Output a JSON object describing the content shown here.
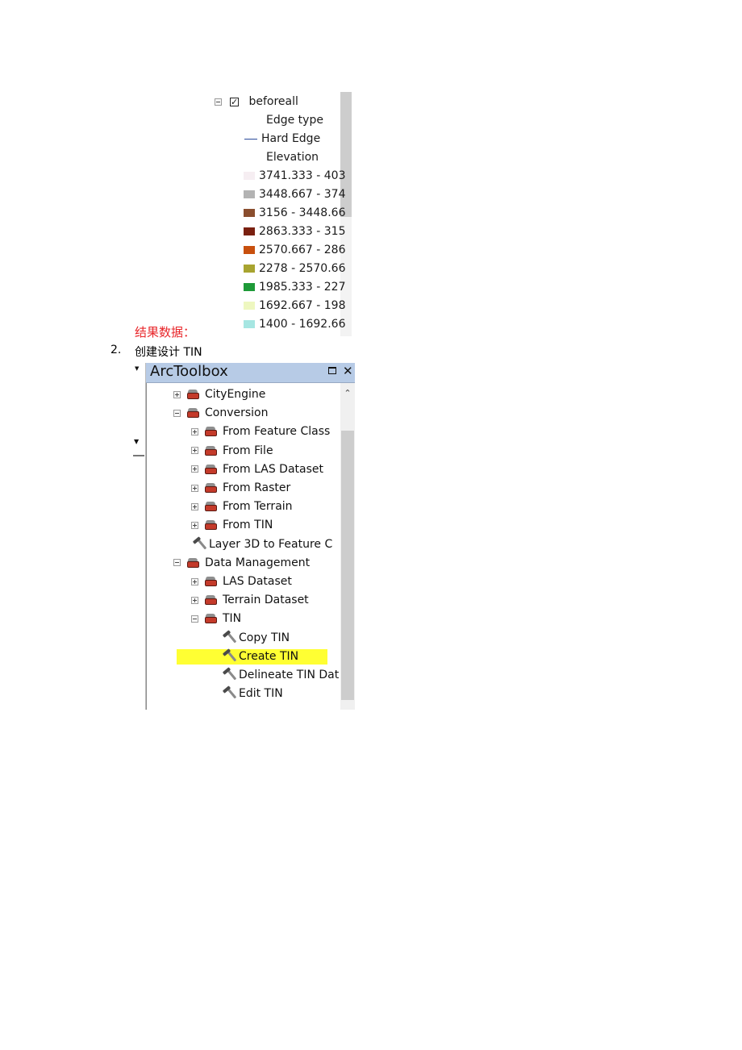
{
  "legend": {
    "layer_name": "beforeall",
    "layer_checked": true,
    "groups": [
      {
        "heading": "Edge type",
        "items": [
          {
            "label": "Hard Edge",
            "symbol": "line",
            "color": "#2a4a9a"
          }
        ]
      },
      {
        "heading": "Elevation",
        "items": [
          {
            "label": "3741.333 - 403",
            "symbol": "swatch",
            "color": "#f6eef2"
          },
          {
            "label": "3448.667 - 374",
            "symbol": "swatch",
            "color": "#b3b3b3"
          },
          {
            "label": "3156 - 3448.66",
            "symbol": "swatch",
            "color": "#8a4e2e"
          },
          {
            "label": "2863.333 - 315",
            "symbol": "swatch",
            "color": "#7a2010"
          },
          {
            "label": "2570.667 - 286",
            "symbol": "swatch",
            "color": "#c8500e"
          },
          {
            "label": "2278 - 2570.66",
            "symbol": "swatch",
            "color": "#a8a430"
          },
          {
            "label": "1985.333 - 227",
            "symbol": "swatch",
            "color": "#1e9a38"
          },
          {
            "label": "1692.667 - 198",
            "symbol": "swatch",
            "color": "#eef7c0"
          },
          {
            "label": "1400 - 1692.66",
            "symbol": "swatch",
            "color": "#a6e6e2"
          }
        ]
      }
    ]
  },
  "doc": {
    "result_label": "结果数据：",
    "step_number": "2.",
    "step_text": "创建设计 TIN"
  },
  "toolbox": {
    "title": "ArcToolbox",
    "highlight_color": "#ffff33",
    "items": [
      {
        "label": "CityEngine",
        "level": 0,
        "toggle": "plus",
        "icon": "toolbox"
      },
      {
        "label": "Conversion",
        "level": 0,
        "toggle": "minus",
        "icon": "toolbox"
      },
      {
        "label": "From Feature Class",
        "level": 1,
        "toggle": "plus",
        "icon": "toolbox"
      },
      {
        "label": "From File",
        "level": 1,
        "toggle": "plus",
        "icon": "toolbox"
      },
      {
        "label": "From LAS Dataset",
        "level": 1,
        "toggle": "plus",
        "icon": "toolbox"
      },
      {
        "label": "From Raster",
        "level": 1,
        "toggle": "plus",
        "icon": "toolbox"
      },
      {
        "label": "From Terrain",
        "level": 1,
        "toggle": "plus",
        "icon": "toolbox"
      },
      {
        "label": "From TIN",
        "level": 1,
        "toggle": "plus",
        "icon": "toolbox"
      },
      {
        "label": "Layer 3D to Feature C",
        "level": 1,
        "toggle": "none",
        "icon": "hammer"
      },
      {
        "label": "Data Management",
        "level": 0,
        "toggle": "minus",
        "icon": "toolbox"
      },
      {
        "label": "LAS Dataset",
        "level": 1,
        "toggle": "plus",
        "icon": "toolbox"
      },
      {
        "label": "Terrain Dataset",
        "level": 1,
        "toggle": "plus",
        "icon": "toolbox"
      },
      {
        "label": "TIN",
        "level": 1,
        "toggle": "minus",
        "icon": "toolbox"
      },
      {
        "label": "Copy TIN",
        "level": 2,
        "toggle": "none",
        "icon": "hammer"
      },
      {
        "label": "Create TIN",
        "level": 2,
        "toggle": "none",
        "icon": "hammer",
        "highlighted": true
      },
      {
        "label": "Delineate TIN Dat",
        "level": 2,
        "toggle": "none",
        "icon": "hammer"
      },
      {
        "label": "Edit TIN",
        "level": 2,
        "toggle": "none",
        "icon": "hammer"
      }
    ]
  }
}
